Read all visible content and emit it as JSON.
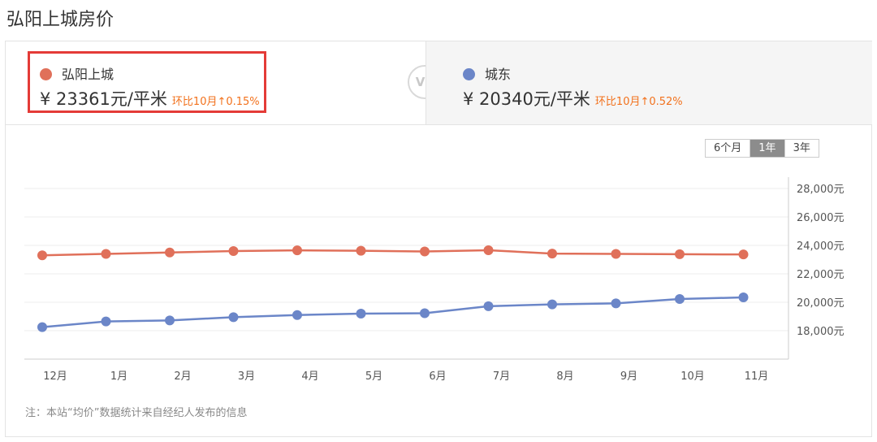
{
  "page_title": "弘阳上城房价",
  "compare": {
    "left": {
      "name": "弘阳上城",
      "price": "¥ 23361元/平米",
      "change": "环比10月↑0.15%",
      "color": "#e0705a"
    },
    "vs": "VS",
    "right": {
      "name": "城东",
      "price": "¥ 20340元/平米",
      "change": "环比10月↑0.52%",
      "color": "#6b86c8"
    }
  },
  "range_tabs": [
    {
      "label": "6个月",
      "active": false
    },
    {
      "label": "1年",
      "active": true
    },
    {
      "label": "3年",
      "active": false
    }
  ],
  "note": "注：本站“均价”数据统计来自经纪人发布的信息",
  "chart_data": {
    "type": "line",
    "categories": [
      "12月",
      "1月",
      "2月",
      "3月",
      "4月",
      "5月",
      "6月",
      "7月",
      "8月",
      "9月",
      "10月",
      "11月"
    ],
    "series": [
      {
        "name": "弘阳上城",
        "color": "#e0705a",
        "values": [
          23300,
          23400,
          23500,
          23600,
          23650,
          23620,
          23570,
          23660,
          23420,
          23400,
          23380,
          23361
        ]
      },
      {
        "name": "城东",
        "color": "#6b86c8",
        "values": [
          18250,
          18650,
          18720,
          18950,
          19100,
          19200,
          19230,
          19720,
          19850,
          19920,
          20230,
          20340
        ]
      }
    ],
    "yticks": [
      18000,
      20000,
      22000,
      24000,
      26000,
      28000
    ],
    "ytick_labels": [
      "18,000元",
      "20,000元",
      "22,000元",
      "24,000元",
      "26,000元",
      "28,000元"
    ],
    "ylim": [
      16000,
      28800
    ],
    "grid": true,
    "y_axis_position": "right"
  }
}
